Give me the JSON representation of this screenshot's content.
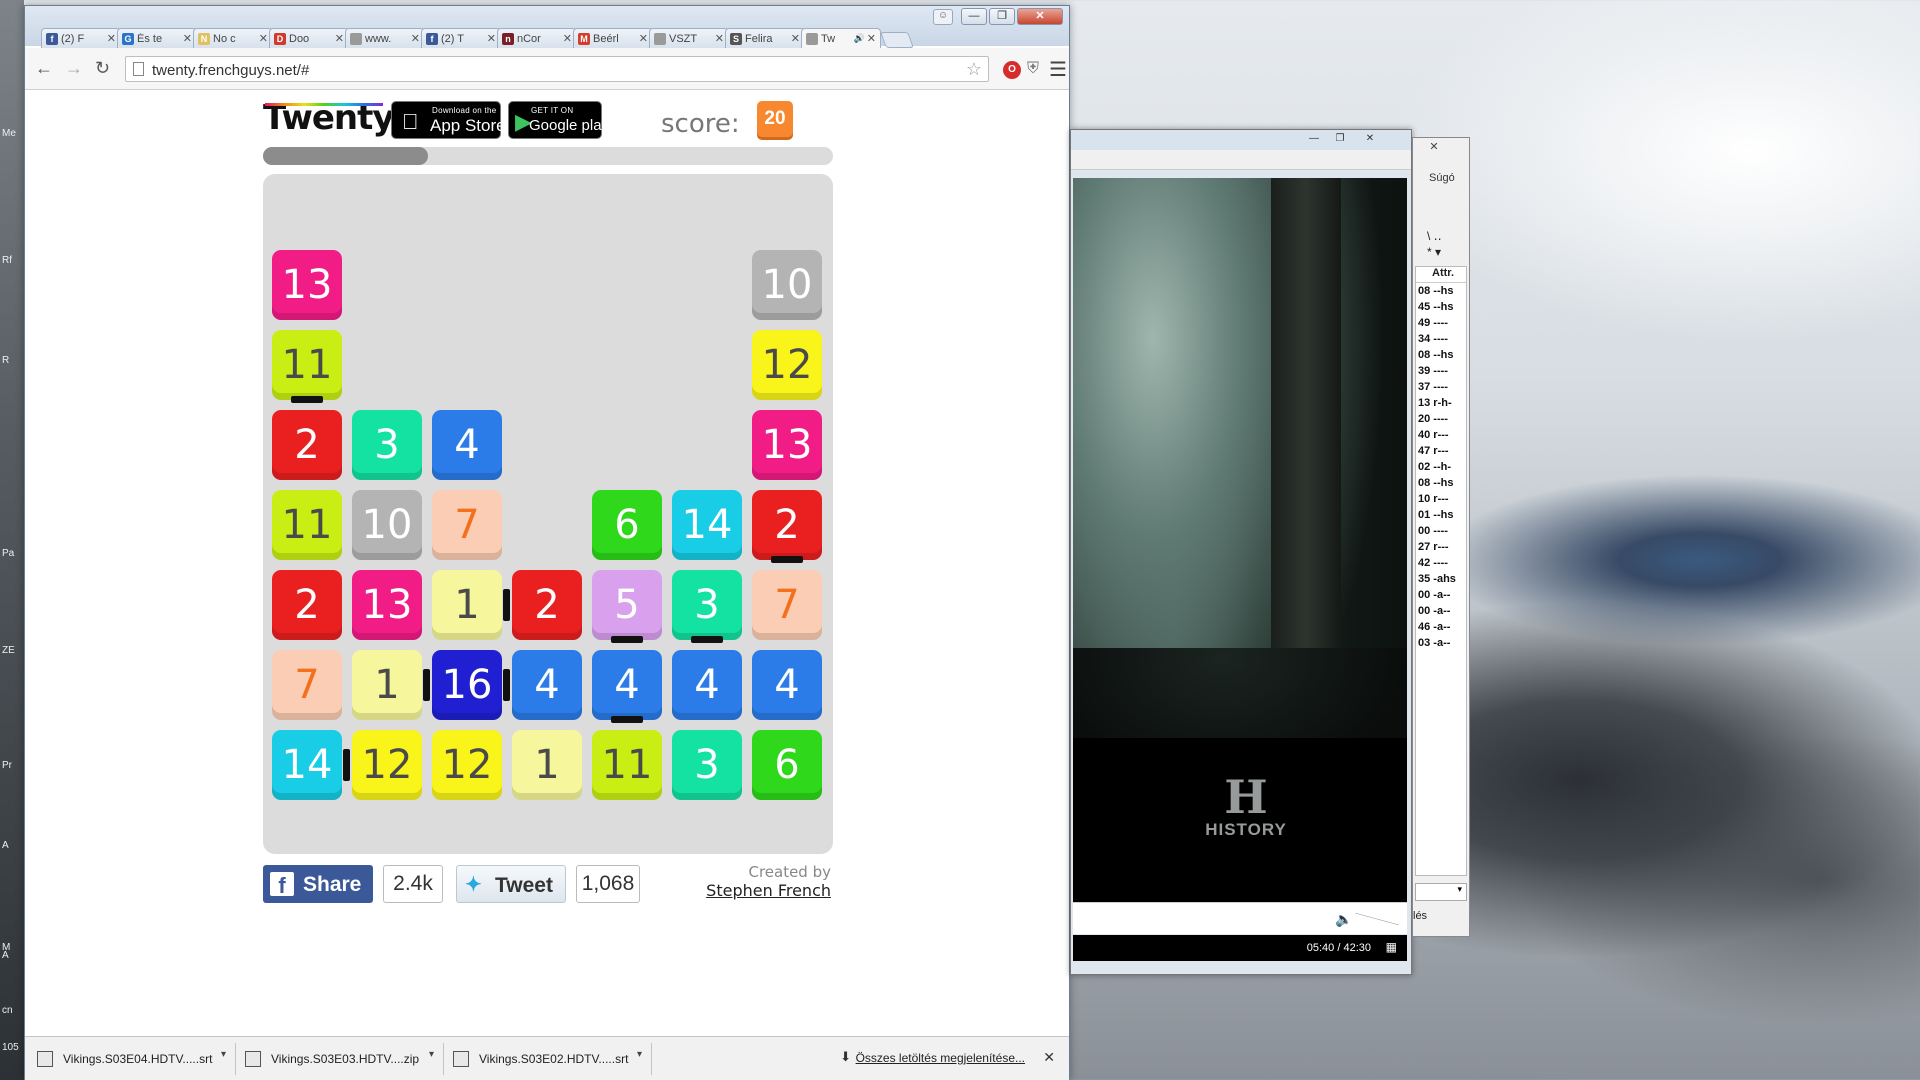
{
  "desktop": {
    "side_labels": [
      "Me",
      "Rf",
      "R",
      "Pa",
      "ZE",
      "A",
      "Pr",
      "A",
      "M",
      "cn",
      "105"
    ]
  },
  "browser": {
    "tabs": [
      {
        "title": "(2) F",
        "icon": "facebook-icon",
        "color": "#3b5998",
        "glyph": "f"
      },
      {
        "title": "És te",
        "icon": "gs-icon",
        "color": "#2a74c9",
        "glyph": "G"
      },
      {
        "title": "No c",
        "icon": "note-icon",
        "color": "#e0c060",
        "glyph": "N"
      },
      {
        "title": "Doo",
        "icon": "doodle-icon",
        "color": "#d13a2f",
        "glyph": "D"
      },
      {
        "title": "www.",
        "icon": "page-icon",
        "color": "#9a9a9a",
        "glyph": ""
      },
      {
        "title": "(2) T",
        "icon": "facebook-icon",
        "color": "#3b5998",
        "glyph": "f"
      },
      {
        "title": "nCor",
        "icon": "ncore-icon",
        "color": "#7a1e2a",
        "glyph": "n"
      },
      {
        "title": "Beérl",
        "icon": "gmail-icon",
        "color": "#d33c2c",
        "glyph": "M"
      },
      {
        "title": "VSZT",
        "icon": "page-icon",
        "color": "#9a9a9a",
        "glyph": ""
      },
      {
        "title": "Felira",
        "icon": "feliratok-icon",
        "color": "#555555",
        "glyph": "S"
      },
      {
        "title": "Tw",
        "icon": "page-icon",
        "color": "#9a9a9a",
        "glyph": "",
        "active": true,
        "audio": true
      }
    ],
    "url": "twenty.frenchguys.net/#"
  },
  "game": {
    "logo": "Twenty",
    "appstore_small": "Download on the",
    "appstore_big": "App Store",
    "googleplay_small": "GET IT ON",
    "googleplay_big": "Google play",
    "score_label": "score:",
    "score_value": "20",
    "progress": 0.29,
    "colors": {
      "1": "#f6f69c",
      "2": "#ea1f1f",
      "3": "#14e2a3",
      "4": "#2b7ce9",
      "5": "#d9a0ee",
      "6": "#2fd81a",
      "7": "#fbcdb4",
      "10": "#b4b4b4",
      "11": "#c9ee14",
      "12": "#f9f51b",
      "13": "#f21c86",
      "14": "#18cde5",
      "16": "#2020d2"
    },
    "grid": [
      [
        null,
        null,
        null,
        null,
        null,
        null,
        null
      ],
      [
        null,
        null,
        null,
        null,
        null,
        null,
        null
      ],
      [
        13,
        null,
        null,
        null,
        null,
        null,
        10
      ],
      [
        11,
        null,
        null,
        null,
        null,
        null,
        12
      ],
      [
        2,
        3,
        4,
        null,
        null,
        null,
        13
      ],
      [
        11,
        10,
        7,
        null,
        6,
        14,
        2
      ],
      [
        2,
        13,
        1,
        2,
        5,
        3,
        7
      ],
      [
        7,
        1,
        16,
        4,
        4,
        4,
        4
      ],
      [
        14,
        12,
        12,
        1,
        11,
        3,
        6
      ]
    ],
    "links_vertical": [
      [
        3,
        0
      ],
      [
        5,
        6
      ],
      [
        6,
        4
      ],
      [
        6,
        5
      ],
      [
        7,
        4
      ]
    ],
    "links_horizontal": [
      [
        6,
        2
      ],
      [
        7,
        1
      ],
      [
        7,
        2
      ],
      [
        8,
        0
      ]
    ]
  },
  "social": {
    "share_label": "Share",
    "share_count": "2.4k",
    "tweet_label": "Tweet",
    "tweet_count": "1,068",
    "created_by": "Created by",
    "author": "Stephen French"
  },
  "downloads": {
    "items": [
      "Vikings.S03E04.HDTV.....srt",
      "Vikings.S03E03.HDTV....zip",
      "Vikings.S03E02.HDTV.....srt"
    ],
    "show_all": "Összes letöltés megjelenítése..."
  },
  "player": {
    "channel_logo": "HISTORY",
    "time": "05:40 / 42:30"
  },
  "subtitle_window": {
    "menu_help": "Súgó",
    "column_header": "Attr.",
    "rows": [
      "08 --hs",
      "45 --hs",
      "49 ----",
      "34 ----",
      "08 --hs",
      "39 ----",
      "37 ----",
      "13 r-h-",
      "20 ----",
      "40 r---",
      "47 r---",
      "02 --h-",
      "08 --hs",
      "10 r---",
      "01 --hs",
      "00 ----",
      "27 r---",
      "42 ----",
      "35 -ahs",
      "00 -a--",
      "00 -a--",
      "46 -a--",
      "03 -a--"
    ],
    "footer": "lés"
  }
}
